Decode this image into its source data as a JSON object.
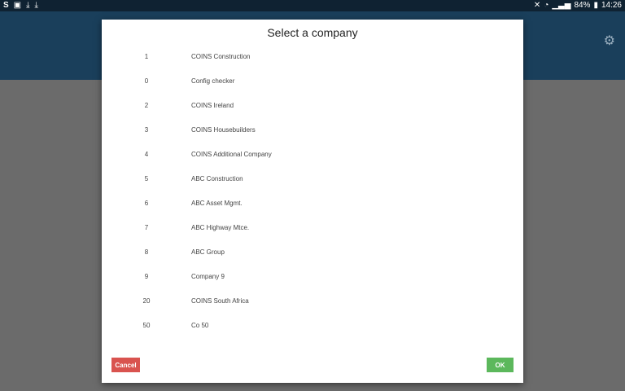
{
  "status_bar": {
    "left_icons": [
      "samsung-s-icon",
      "gallery-icon",
      "download-icon",
      "download-icon"
    ],
    "battery": "84%",
    "time": "14:26"
  },
  "dialog": {
    "title": "Select a company",
    "companies": [
      {
        "num": "1",
        "name": "COINS Construction"
      },
      {
        "num": "0",
        "name": "Config checker"
      },
      {
        "num": "2",
        "name": "COINS Ireland"
      },
      {
        "num": "3",
        "name": "COINS Housebuilders"
      },
      {
        "num": "4",
        "name": "COINS Additional Company"
      },
      {
        "num": "5",
        "name": "ABC Construction"
      },
      {
        "num": "6",
        "name": "ABC Asset Mgmt."
      },
      {
        "num": "7",
        "name": "ABC Highway Mtce."
      },
      {
        "num": "8",
        "name": "ABC Group"
      },
      {
        "num": "9",
        "name": "Company 9"
      },
      {
        "num": "20",
        "name": "COINS South Africa"
      },
      {
        "num": "50",
        "name": "Co 50"
      }
    ],
    "cancel_label": "Cancel",
    "ok_label": "OK"
  },
  "colors": {
    "appbar": "#1a3f5b",
    "statusbar": "#0f2232",
    "cancel": "#d9534f",
    "ok": "#5cb85c"
  }
}
